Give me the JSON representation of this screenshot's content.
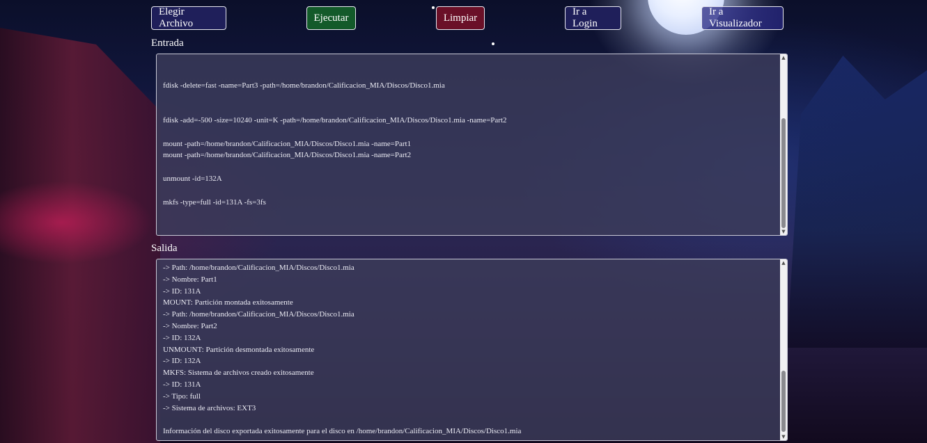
{
  "buttons": {
    "elegir": "Elegir Archivo",
    "ejecutar": "Ejecutar",
    "limpiar": "Limpiar",
    "login": "Ir a Login",
    "visualizador": "Ir a Visualizador"
  },
  "entrada": {
    "label": "Entrada",
    "lines": [
      "",
      "",
      "fdisk -delete=fast -name=Part3 -path=/home/brandon/Calificacion_MIA/Discos/Disco1.mia",
      "",
      "",
      "fdisk -add=-500 -size=10240 -unit=K -path=/home/brandon/Calificacion_MIA/Discos/Disco1.mia -name=Part2",
      "",
      "mount -path=/home/brandon/Calificacion_MIA/Discos/Disco1.mia -name=Part1",
      "mount -path=/home/brandon/Calificacion_MIA/Discos/Disco1.mia -name=Part2",
      "",
      "unmount -id=132A",
      "",
      "mkfs -type=full -id=131A -fs=3fs"
    ]
  },
  "salida": {
    "label": "Salida",
    "lines": [
      "-> Path: /home/brandon/Calificacion_MIA/Discos/Disco1.mia",
      "-> Nombre: Part1",
      "-> ID: 131A",
      "MOUNT: Partición montada exitosamente",
      "-> Path: /home/brandon/Calificacion_MIA/Discos/Disco1.mia",
      "-> Nombre: Part2",
      "-> ID: 132A",
      "UNMOUNT: Partición desmontada exitosamente",
      "-> ID: 132A",
      "MKFS: Sistema de archivos creado exitosamente",
      "-> ID: 131A",
      "-> Tipo: full",
      "-> Sistema de archivos: EXT3",
      "",
      "Información del disco exportada exitosamente para el disco en /home/brandon/Calificacion_MIA/Discos/Disco1.mia"
    ]
  },
  "icons": {
    "scroll_up": "▲",
    "scroll_down": "▼"
  }
}
